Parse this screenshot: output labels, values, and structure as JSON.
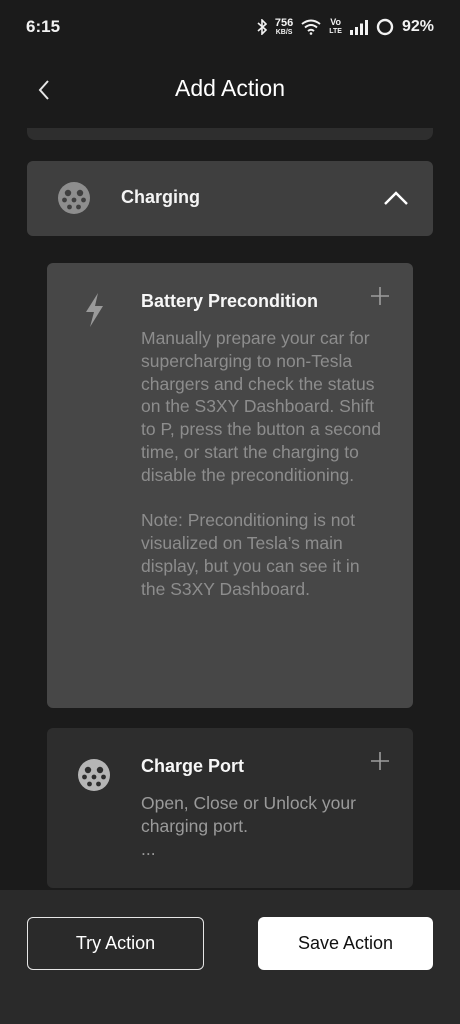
{
  "status_bar": {
    "time": "6:15",
    "net_speed_value": "756",
    "net_speed_unit": "KB/S",
    "volte_top": "Vo",
    "volte_bottom": "LTE",
    "battery": "92%"
  },
  "header": {
    "title": "Add Action",
    "back_icon": "chevron-left-icon"
  },
  "category": {
    "label": "Charging",
    "icon": "charge-port-icon",
    "expanded": true,
    "toggle_icon": "chevron-up-icon"
  },
  "actions": [
    {
      "title": "Battery Precondition",
      "icon": "lightning-bolt-icon",
      "description": "Manually prepare your car for supercharging to non-Tesla chargers and check the status on the S3XY Dashboard. Shift to P, press the button a second time, or start the charging to disable the preconditioning.\n\nNote: Preconditioning is not visualized on Tesla’s main display, but you can see it in the S3XY Dashboard."
    },
    {
      "title": "Charge Port",
      "icon": "charge-port-icon",
      "description": "Open, Close or Unlock your charging port.\n..."
    }
  ],
  "footer": {
    "try_label": "Try Action",
    "save_label": "Save Action"
  },
  "colors": {
    "background": "#1b1b1b",
    "category_bg": "#3f3f3f",
    "selected_card_bg": "#474747",
    "card_bg": "#2d2d2d",
    "primary_button_bg": "#ffffff"
  }
}
